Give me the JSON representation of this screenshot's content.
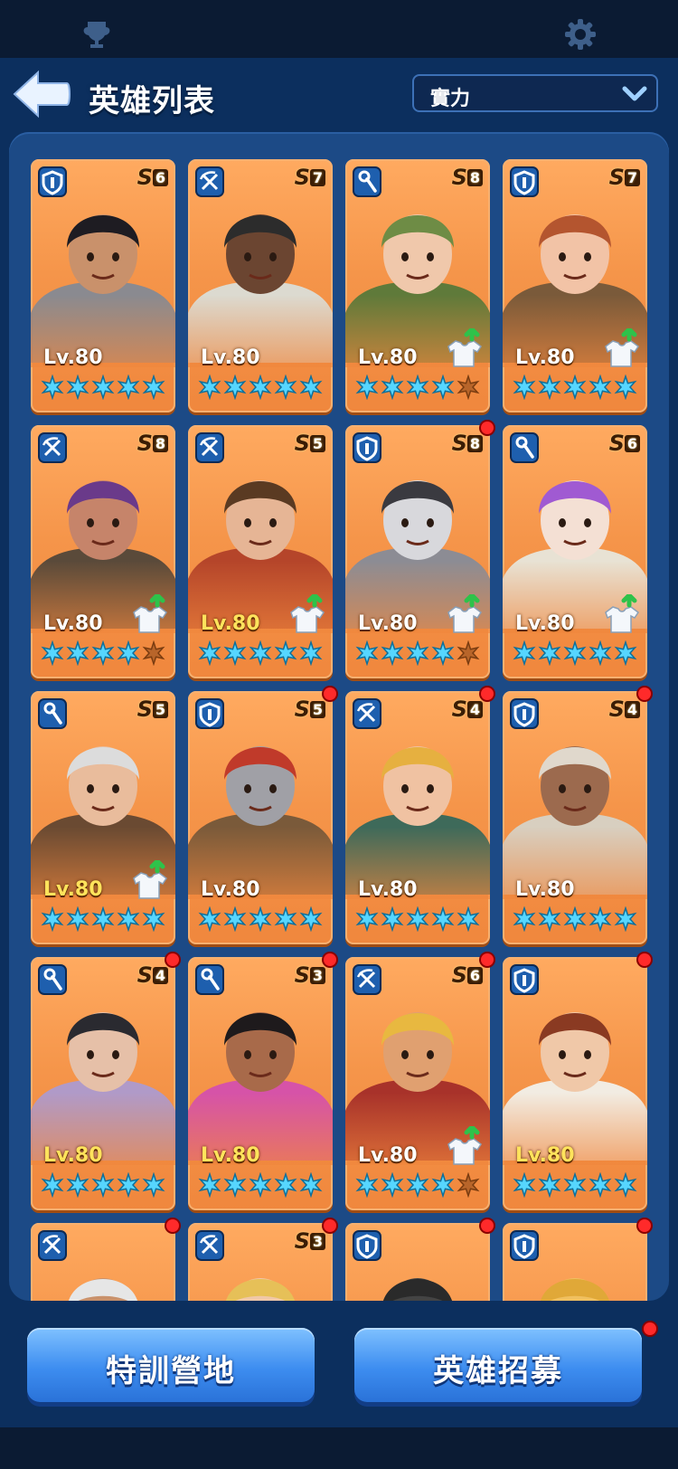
{
  "header": {
    "title": "英雄列表",
    "sort_value": "實力"
  },
  "buttons": {
    "train": "特訓營地",
    "recruit": "英雄招募"
  },
  "colors": {
    "card": "#f5954a",
    "star": "#56d6ff",
    "star_empty": "#b8652a",
    "notify": "#ff2a2a",
    "button": "#3d8df0"
  },
  "heroes": [
    {
      "class": "shield-icon",
      "rank": "S",
      "rank_num": "6",
      "level": "Lv.80",
      "level_gold": false,
      "stars": 5,
      "upgrade": false,
      "notify": false,
      "skin": "#c9916b",
      "hair": "#1e1c22",
      "cloth": "#8a8a90"
    },
    {
      "class": "crossbow-icon",
      "rank": "S",
      "rank_num": "7",
      "level": "Lv.80",
      "level_gold": false,
      "stars": 5,
      "upgrade": false,
      "notify": false,
      "skin": "#6b4531",
      "hair": "#2c2c2c",
      "cloth": "#dcdad0"
    },
    {
      "class": "staff-icon",
      "rank": "S",
      "rank_num": "8",
      "level": "Lv.80",
      "level_gold": false,
      "stars": 4,
      "upgrade": true,
      "notify": false,
      "skin": "#f0c8ab",
      "hair": "#6e8c45",
      "cloth": "#5f7a3a"
    },
    {
      "class": "shield-icon",
      "rank": "S",
      "rank_num": "7",
      "level": "Lv.80",
      "level_gold": false,
      "stars": 5,
      "upgrade": true,
      "notify": false,
      "skin": "#f2c3a6",
      "hair": "#b4552f",
      "cloth": "#7a5a3a"
    },
    {
      "class": "crossbow-icon",
      "rank": "S",
      "rank_num": "8",
      "level": "Lv.80",
      "level_gold": false,
      "stars": 4,
      "upgrade": true,
      "notify": false,
      "skin": "#c6846a",
      "hair": "#6a3a8a",
      "cloth": "#5a4a3a"
    },
    {
      "class": "crossbow-icon",
      "rank": "S",
      "rank_num": "5",
      "level": "Lv.80",
      "level_gold": true,
      "stars": 5,
      "upgrade": true,
      "notify": false,
      "skin": "#e6b595",
      "hair": "#5a3a22",
      "cloth": "#b5452a"
    },
    {
      "class": "shield-icon",
      "rank": "S",
      "rank_num": "8",
      "level": "Lv.80",
      "level_gold": false,
      "stars": 4,
      "upgrade": true,
      "notify": true,
      "skin": "#d8d8dc",
      "hair": "#3a3a40",
      "cloth": "#8c8c94"
    },
    {
      "class": "staff-icon",
      "rank": "S",
      "rank_num": "6",
      "level": "Lv.80",
      "level_gold": false,
      "stars": 5,
      "upgrade": true,
      "notify": false,
      "skin": "#f4e0d4",
      "hair": "#a05ad2",
      "cloth": "#e8e2d4"
    },
    {
      "class": "staff-icon",
      "rank": "S",
      "rank_num": "5",
      "level": "Lv.80",
      "level_gold": true,
      "stars": 5,
      "upgrade": true,
      "notify": false,
      "skin": "#e9bc9c",
      "hair": "#dcdcdc",
      "cloth": "#6a4a32"
    },
    {
      "class": "shield-icon",
      "rank": "S",
      "rank_num": "5",
      "level": "Lv.80",
      "level_gold": false,
      "stars": 5,
      "upgrade": false,
      "notify": true,
      "skin": "#a0a0a6",
      "hair": "#c03a2a",
      "cloth": "#7a5a3a"
    },
    {
      "class": "crossbow-icon",
      "rank": "S",
      "rank_num": "4",
      "level": "Lv.80",
      "level_gold": false,
      "stars": 5,
      "upgrade": false,
      "notify": true,
      "skin": "#f0c2a2",
      "hair": "#e6b040",
      "cloth": "#3e6a5a"
    },
    {
      "class": "shield-icon",
      "rank": "S",
      "rank_num": "4",
      "level": "Lv.80",
      "level_gold": false,
      "stars": 5,
      "upgrade": false,
      "notify": true,
      "skin": "#9c6a4e",
      "hair": "#e0d8cc",
      "cloth": "#d8cfc0"
    },
    {
      "class": "staff-icon",
      "rank": "S",
      "rank_num": "4",
      "level": "Lv.80",
      "level_gold": true,
      "stars": 5,
      "upgrade": false,
      "notify": true,
      "skin": "#e6c0a8",
      "hair": "#2a2a30",
      "cloth": "#b09ac8"
    },
    {
      "class": "staff-icon",
      "rank": "S",
      "rank_num": "3",
      "level": "Lv.80",
      "level_gold": true,
      "stars": 5,
      "upgrade": false,
      "notify": true,
      "skin": "#a86a4a",
      "hair": "#1e1a1c",
      "cloth": "#d653a8"
    },
    {
      "class": "crossbow-icon",
      "rank": "S",
      "rank_num": "6",
      "level": "Lv.80",
      "level_gold": false,
      "stars": 4,
      "upgrade": true,
      "notify": true,
      "skin": "#e0a070",
      "hair": "#e8b840",
      "cloth": "#a8322a"
    },
    {
      "class": "shield-icon",
      "rank": "",
      "rank_num": "",
      "level": "Lv.80",
      "level_gold": true,
      "stars": 5,
      "upgrade": false,
      "notify": true,
      "skin": "#f0c8a8",
      "hair": "#8a3a22",
      "cloth": "#f2ece2"
    },
    {
      "class": "crossbow-icon",
      "rank": "",
      "rank_num": "",
      "level": "",
      "level_gold": false,
      "stars": 0,
      "upgrade": false,
      "notify": true,
      "skin": "#c9916b",
      "hair": "#e6e6e6",
      "cloth": "#8a8a90"
    },
    {
      "class": "crossbow-icon",
      "rank": "S",
      "rank_num": "3",
      "level": "",
      "level_gold": false,
      "stars": 0,
      "upgrade": false,
      "notify": true,
      "skin": "#f0c8a8",
      "hair": "#e6c058",
      "cloth": "#e6c058"
    },
    {
      "class": "shield-icon",
      "rank": "",
      "rank_num": "",
      "level": "",
      "level_gold": false,
      "stars": 0,
      "upgrade": false,
      "notify": true,
      "skin": "#444",
      "hair": "#2a2a2a",
      "cloth": "#2a2a2a"
    },
    {
      "class": "shield-icon",
      "rank": "",
      "rank_num": "",
      "level": "",
      "level_gold": false,
      "stars": 0,
      "upgrade": false,
      "notify": true,
      "skin": "#f0c060",
      "hair": "#e0a838",
      "cloth": "#e0a838"
    }
  ],
  "recruit_notify": true
}
